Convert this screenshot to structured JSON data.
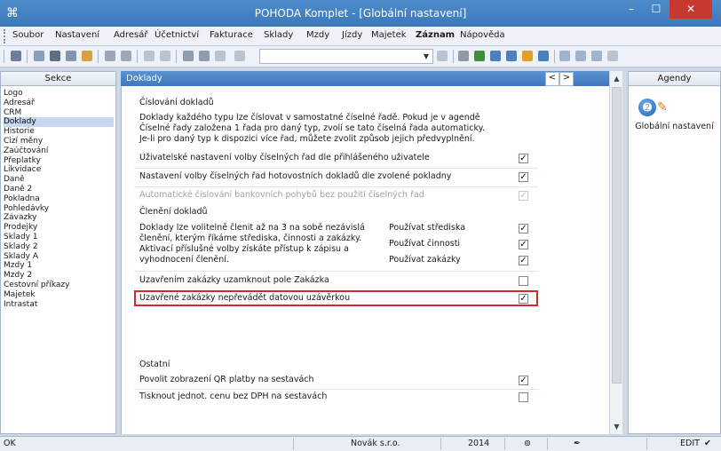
{
  "window": {
    "title": "POHODA Komplet - [Globální nastavení]",
    "buttons": {
      "minimize": "–",
      "maximize": "☐",
      "close": "✕"
    }
  },
  "menu": [
    "Soubor",
    "Nastavení",
    "Adresář",
    "Účetnictví",
    "Fakturace",
    "Sklady",
    "Mzdy",
    "Jízdy",
    "Majetek",
    "Záznam",
    "Nápověda"
  ],
  "toolbar": {
    "combo_value": ""
  },
  "sekce": {
    "header": "Sekce",
    "selected": "Doklady",
    "items": [
      "Logo",
      "Adresář",
      "CRM",
      "Doklady",
      "Historie",
      "Cizí měny",
      "Zaúčtování",
      "Přeplatky",
      "Likvidace",
      "Daně",
      "Daně 2",
      "Pokladna",
      "Pohledávky",
      "Závazky",
      "Prodejky",
      "Sklady 1",
      "Sklady 2",
      "Sklady A",
      "Mzdy 1",
      "Mzdy 2",
      "Cestovní příkazy",
      "Majetek",
      "Intrastat"
    ]
  },
  "main": {
    "title": "Doklady",
    "nav_prev": "<",
    "nav_next": ">",
    "cislovani": {
      "heading": "Číslování dokladů",
      "desc": [
        "Doklady každého typu lze číslovat v samostatné číselné řadě. Pokud je v agendě",
        "Číselné řady založena 1 řada pro daný typ, zvolí se tato číselná řada automaticky.",
        "Je-li pro daný typ k dispozici více řad, můžete zvolit způsob jejich předvyplnění."
      ],
      "options": [
        {
          "label": "Uživatelské nastavení volby číselných řad dle přihlášeného uživatele",
          "checked": true,
          "disabled": false
        },
        {
          "label": "Nastavení volby číselných řad hotovostních dokladů dle zvolené pokladny",
          "checked": true,
          "disabled": false
        },
        {
          "label": "Automatické číslování bankovních pohybů bez použití číselných řad",
          "checked": true,
          "disabled": true
        }
      ]
    },
    "cleneni": {
      "heading": "Členění dokladů",
      "desc": [
        "Doklady lze volitelně členit až na 3 na sobě nezávislá",
        "členění, kterým říkáme střediska, činnosti a zakázky.",
        "Aktivací příslušné volby získáte přístup k zápisu a",
        "vyhodnocení členění."
      ],
      "options": [
        {
          "label": "Používat střediska",
          "checked": true
        },
        {
          "label": "Používat činnosti",
          "checked": true
        },
        {
          "label": "Používat zakázky",
          "checked": true
        }
      ],
      "uzamknout": {
        "label": "Uzavřením zakázky uzamknout pole Zakázka",
        "checked": false
      },
      "neprevadet": {
        "label": "Uzavřené zakázky nepřevádět datovou uzávěrkou",
        "checked": true
      }
    },
    "ostatni": {
      "heading": "Ostatní",
      "options": [
        {
          "label": "Povolit zobrazení QR platby na sestavách",
          "checked": true
        },
        {
          "label": "Tisknout jednot. cenu bez DPH na sestavách",
          "checked": false
        }
      ]
    }
  },
  "agendy": {
    "header": "Agendy",
    "item_label": "Globální nastavení"
  },
  "status": {
    "left": "OK",
    "company": "Novák s.r.o.",
    "year": "2014",
    "mode": "EDIT"
  }
}
